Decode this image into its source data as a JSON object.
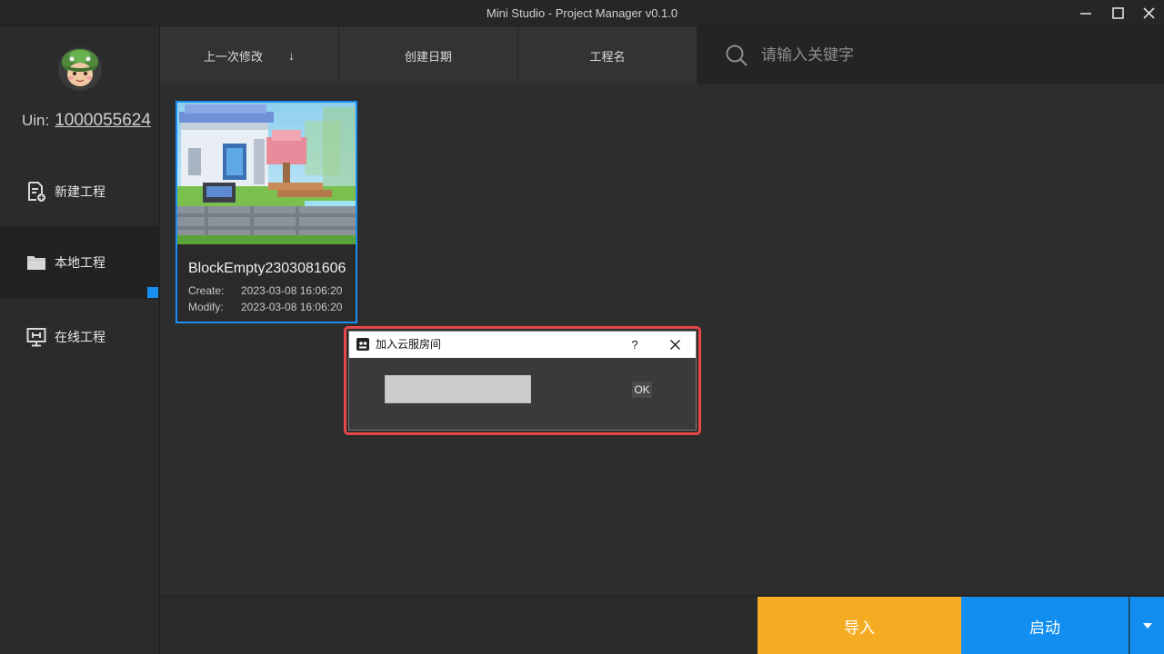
{
  "window": {
    "title": "Mini Studio - Project Manager v0.1.0"
  },
  "sidebar": {
    "uin_label": "Uin:",
    "uin_value": "1000055624",
    "items": [
      {
        "label": "新建工程",
        "icon": "new-project-icon"
      },
      {
        "label": "本地工程",
        "icon": "folder-icon",
        "active": true
      },
      {
        "label": "在线工程",
        "icon": "monitor-icon"
      }
    ]
  },
  "toolbar": {
    "sort_options": [
      {
        "label": "上一次修改",
        "arrow": "↓"
      },
      {
        "label": "创建日期"
      },
      {
        "label": "工程名"
      }
    ],
    "search_placeholder": "请输入关键字"
  },
  "projects": [
    {
      "name": "BlockEmpty2303081606",
      "create_label": "Create:",
      "create_value": "2023-03-08 16:06:20",
      "modify_label": "Modify:",
      "modify_value": "2023-03-08 16:06:20"
    }
  ],
  "bottom": {
    "import_label": "导入",
    "launch_label": "启动"
  },
  "dialog": {
    "title": "加入云服房间",
    "help": "?",
    "input_value": "",
    "ok_label": "OK"
  },
  "colors": {
    "accent_blue": "#118ef0",
    "import_orange": "#f4ad23",
    "highlight_red": "#e8474a",
    "background": "#2d2d2d"
  }
}
